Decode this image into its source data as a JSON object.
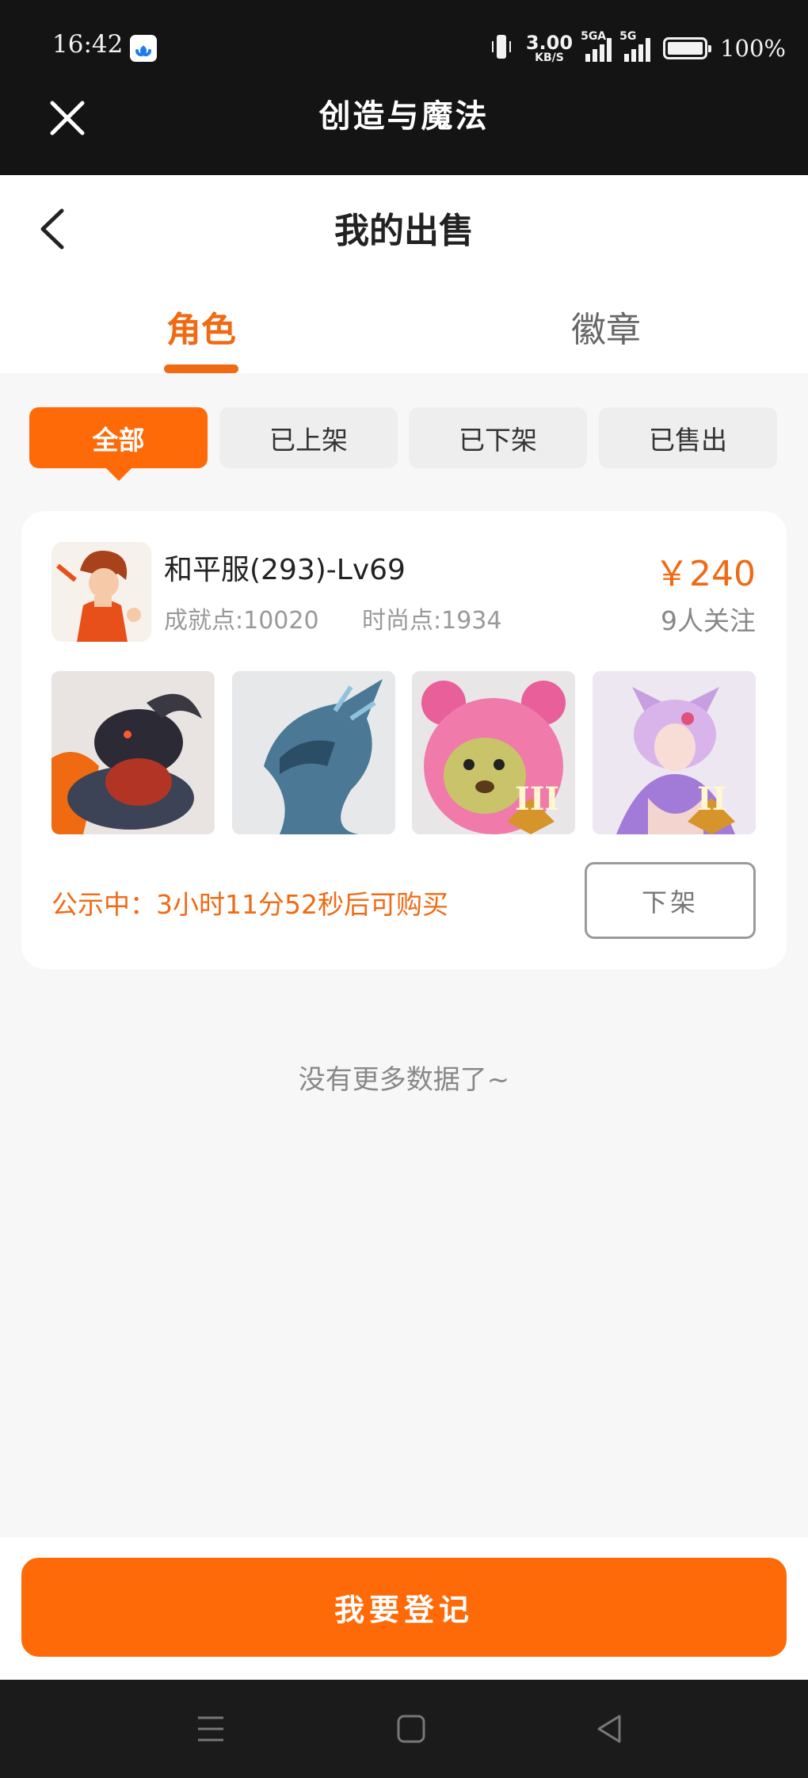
{
  "status_bar": {
    "time": "16:42",
    "net_speed_value": "3.00",
    "net_speed_unit": "KB/S",
    "sim1_tag": "5GA",
    "sim2_tag": "5G",
    "battery_pct": "100%",
    "icons": [
      "app-badge-icon",
      "vibrate-icon",
      "signal-icon",
      "signal-icon",
      "battery-icon"
    ]
  },
  "app_bar": {
    "title": "创造与魔法"
  },
  "header": {
    "title": "我的出售"
  },
  "tabs": [
    {
      "label": "角色",
      "active": true
    },
    {
      "label": "徽章",
      "active": false
    }
  ],
  "filters": [
    {
      "label": "全部",
      "active": true
    },
    {
      "label": "已上架",
      "active": false
    },
    {
      "label": "已下架",
      "active": false
    },
    {
      "label": "已售出",
      "active": false
    }
  ],
  "listing": {
    "name": "和平服(293)-Lv69",
    "achievement": "成就点:10020",
    "fashion": "时尚点:1934",
    "price": "￥240",
    "followers": "9人关注",
    "items": [
      {
        "icon": "black-beast-mount-icon"
      },
      {
        "icon": "ice-dragon-mount-icon"
      },
      {
        "icon": "pink-bear-pet-icon",
        "grade": "III"
      },
      {
        "icon": "fox-fairy-pet-icon",
        "grade": "II"
      }
    ],
    "notice": "公示中：3小时11分52秒后可购买",
    "delist_label": "下架"
  },
  "empty_hint": "没有更多数据了~",
  "register_label": "我要登记",
  "colors": {
    "accent": "#ff6a08",
    "accent_text": "#f06a14",
    "dark_bar": "#141414"
  }
}
